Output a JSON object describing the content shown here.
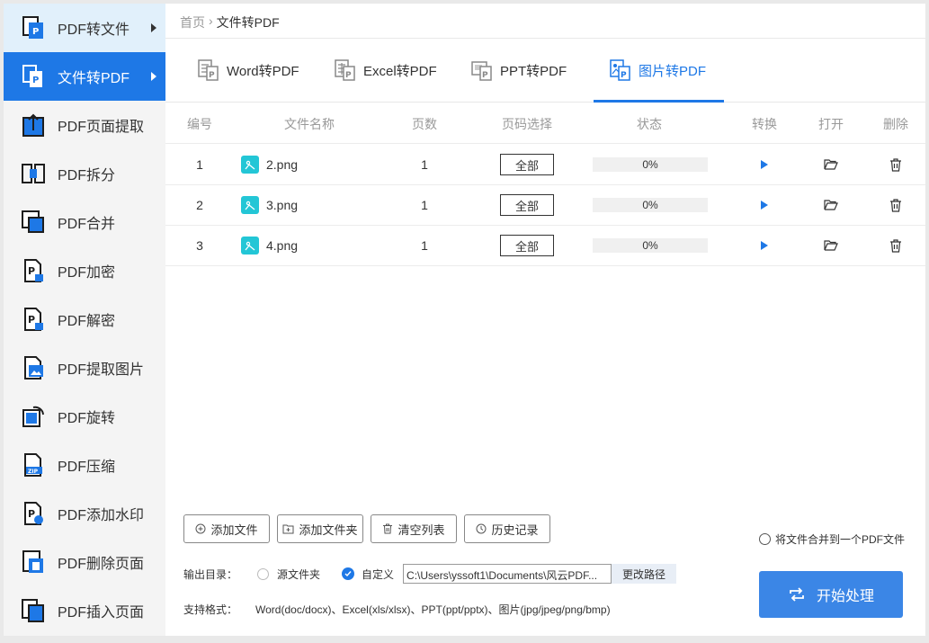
{
  "sidebar": {
    "items": [
      {
        "label": "PDF转文件",
        "icon": "pdf-to-file-icon"
      },
      {
        "label": "文件转PDF",
        "icon": "file-to-pdf-icon"
      },
      {
        "label": "PDF页面提取",
        "icon": "page-extract-icon"
      },
      {
        "label": "PDF拆分",
        "icon": "split-icon"
      },
      {
        "label": "PDF合并",
        "icon": "merge-icon"
      },
      {
        "label": "PDF加密",
        "icon": "lock-icon"
      },
      {
        "label": "PDF解密",
        "icon": "unlock-icon"
      },
      {
        "label": "PDF提取图片",
        "icon": "image-extract-icon"
      },
      {
        "label": "PDF旋转",
        "icon": "rotate-icon"
      },
      {
        "label": "PDF压缩",
        "icon": "zip-icon"
      },
      {
        "label": "PDF添加水印",
        "icon": "watermark-icon"
      },
      {
        "label": "PDF删除页面",
        "icon": "delete-page-icon"
      },
      {
        "label": "PDF插入页面",
        "icon": "insert-page-icon"
      }
    ]
  },
  "breadcrumb": {
    "home": "首页",
    "sep": "›",
    "current": "文件转PDF"
  },
  "tabs": [
    {
      "label": "Word转PDF"
    },
    {
      "label": "Excel转PDF"
    },
    {
      "label": "PPT转PDF"
    },
    {
      "label": "图片转PDF"
    }
  ],
  "table": {
    "headers": [
      "编号",
      "文件名称",
      "页数",
      "页码选择",
      "状态",
      "转换",
      "打开",
      "删除"
    ],
    "rows": [
      {
        "no": "1",
        "name": "2.png",
        "pages": "1",
        "page_select": "全部",
        "status": "0%"
      },
      {
        "no": "2",
        "name": "3.png",
        "pages": "1",
        "page_select": "全部",
        "status": "0%"
      },
      {
        "no": "3",
        "name": "4.png",
        "pages": "1",
        "page_select": "全部",
        "status": "0%"
      }
    ]
  },
  "actions": {
    "add_file": "添加文件",
    "add_folder": "添加文件夹",
    "clear_list": "清空列表",
    "history": "历史记录"
  },
  "merge_option": "将文件合并到一个PDF文件",
  "output": {
    "label": "输出目录：",
    "source_folder": "源文件夹",
    "custom": "自定义",
    "path": "C:\\Users\\yssoft1\\Documents\\风云PDF...",
    "change_path": "更改路径"
  },
  "formats": {
    "label": "支持格式：",
    "list": "Word(doc/docx)、Excel(xls/xlsx)、PPT(ppt/pptx)、图片(jpg/jpeg/png/bmp)"
  },
  "start_button": "开始处理",
  "colors": {
    "accent": "#1e78e6",
    "start": "#3b86e6",
    "file_icon": "#23c6d6"
  }
}
